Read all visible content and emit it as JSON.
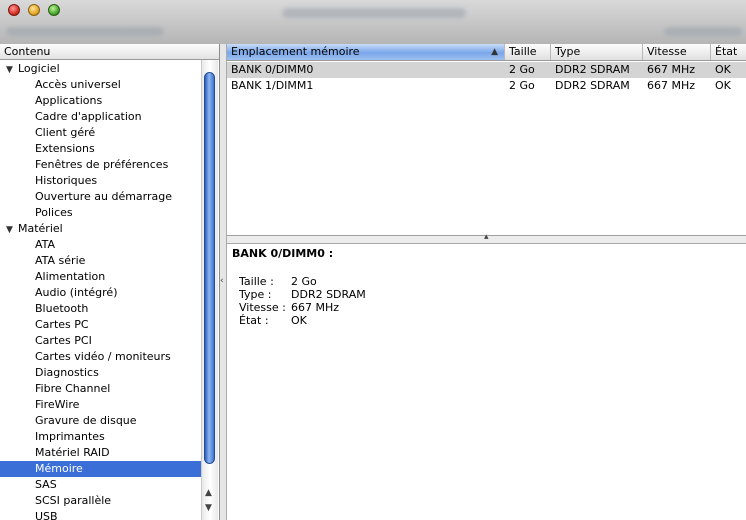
{
  "sidebar": {
    "header": "Contenu",
    "categories": [
      {
        "label": "Logiciel",
        "items": [
          "Accès universel",
          "Applications",
          "Cadre d'application",
          "Client géré",
          "Extensions",
          "Fenêtres de préférences",
          "Historiques",
          "Ouverture au démarrage",
          "Polices"
        ]
      },
      {
        "label": "Matériel",
        "items": [
          "ATA",
          "ATA série",
          "Alimentation",
          "Audio (intégré)",
          "Bluetooth",
          "Cartes PC",
          "Cartes PCI",
          "Cartes vidéo / moniteurs",
          "Diagnostics",
          "Fibre Channel",
          "FireWire",
          "Gravure de disque",
          "Imprimantes",
          "Matériel RAID",
          "Mémoire",
          "SAS",
          "SCSI parallèle",
          "USB"
        ]
      }
    ],
    "selected": "Mémoire"
  },
  "table": {
    "columns": [
      "Emplacement mémoire",
      "Taille",
      "Type",
      "Vitesse",
      "État"
    ],
    "rows": [
      [
        "BANK 0/DIMM0",
        "2 Go",
        "DDR2 SDRAM",
        "667 MHz",
        "OK"
      ],
      [
        "BANK 1/DIMM1",
        "2 Go",
        "DDR2 SDRAM",
        "667 MHz",
        "OK"
      ]
    ]
  },
  "detail": {
    "title": "BANK 0/DIMM0 :",
    "props": [
      {
        "key": "Taille :",
        "value": "2 Go"
      },
      {
        "key": "Type :",
        "value": "DDR2 SDRAM"
      },
      {
        "key": "Vitesse :",
        "value": "667 MHz"
      },
      {
        "key": "État :",
        "value": "OK"
      }
    ]
  },
  "icons": {
    "sort": "triangle-up-icon",
    "disclosure": "triangle-down-icon",
    "splitter": "grip-icon"
  },
  "colors": {
    "selection": "#3a6fd8",
    "row_highlight": "#d4d4d4"
  }
}
